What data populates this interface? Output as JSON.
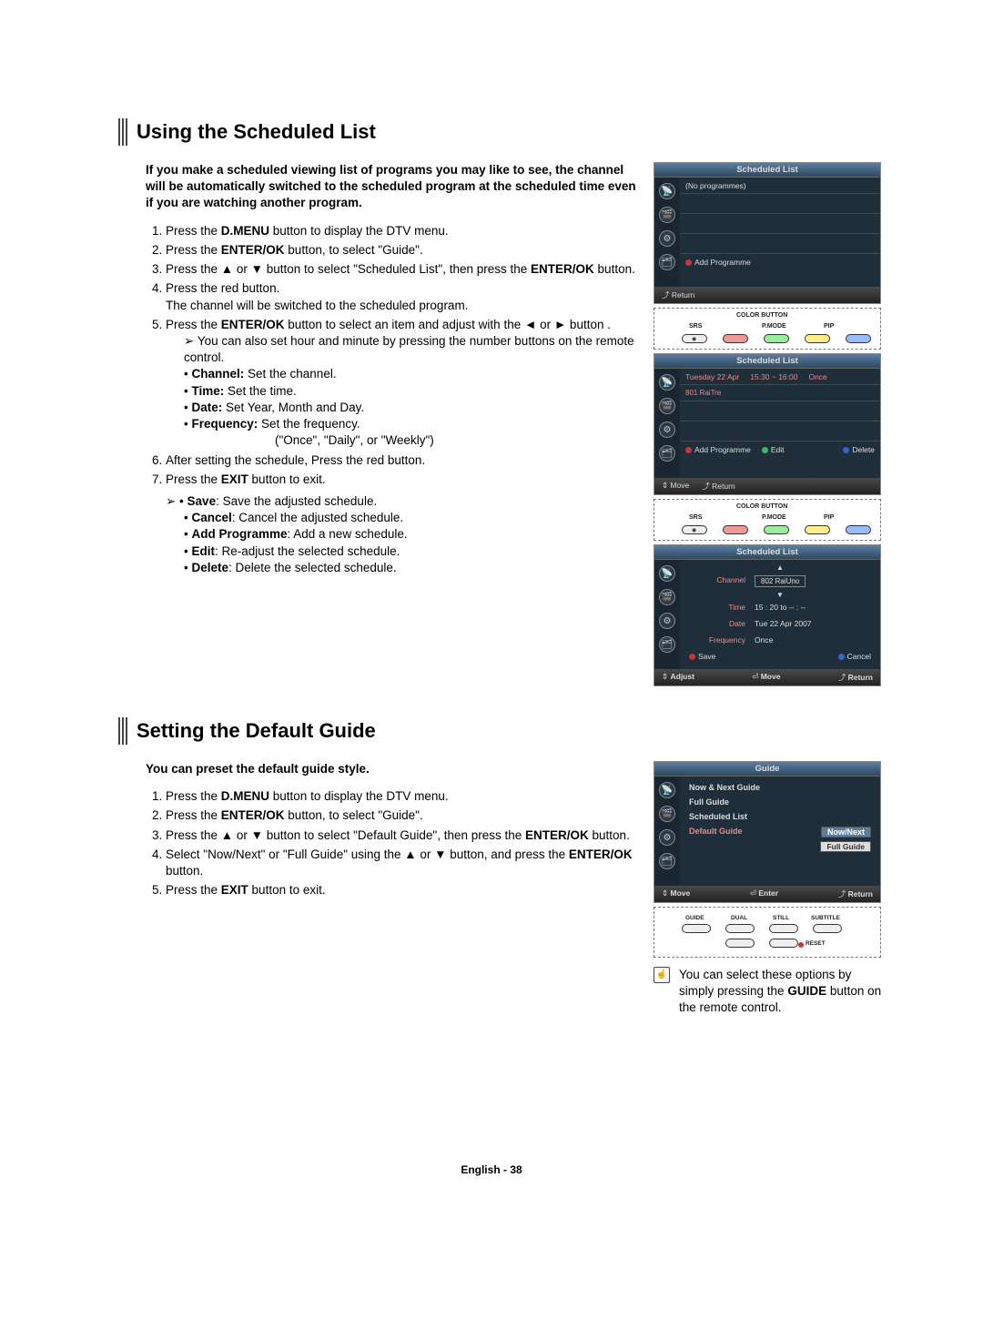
{
  "section1": {
    "title": "Using the Scheduled List",
    "intro": "If you make a scheduled viewing list of programs you may like to see, the channel will be automatically switched to the scheduled program at the scheduled time even if you are watching another program.",
    "s1a": "Press the ",
    "s1b": "D.MENU",
    "s1c": " button to display the DTV menu.",
    "s2a": "Press the ",
    "s2b": "ENTER/OK",
    "s2c": " button, to select \"Guide\".",
    "s3a": "Press the ▲ or ▼ button to select \"Scheduled List\", then press the ",
    "s3b": "ENTER/OK",
    "s3c": " button.",
    "s4a": "Press the red button.",
    "s4b": "The channel will be switched to the scheduled program.",
    "s5a": "Press the ",
    "s5b": "ENTER/OK",
    "s5c": " button to select an item and adjust with the ◄ or ► button .",
    "s5note": "You can also set hour and minute by pressing the number buttons on the remote control.",
    "s5_channel_k": "Channel:",
    "s5_channel_v": " Set the channel.",
    "s5_time_k": "Time:",
    "s5_time_v": " Set the time.",
    "s5_date_k": "Date:",
    "s5_date_v": " Set Year, Month and Day.",
    "s5_freq_k": "Frequency:",
    "s5_freq_v": " Set the frequency.",
    "s5_freq_v2": "(\"Once\", \"Daily\", or \"Weekly\")",
    "s6": "After setting the schedule, Press the red button.",
    "s7a": "Press the ",
    "s7b": "EXIT",
    "s7c": " button to exit.",
    "opt_save_k": "Save",
    "opt_save_v": ": Save the adjusted schedule.",
    "opt_cancel_k": "Cancel",
    "opt_cancel_v": ": Cancel the adjusted schedule.",
    "opt_add_k": "Add Programme",
    "opt_add_v": ": Add a new schedule.",
    "opt_edit_k": "Edit",
    "opt_edit_v": ": Re-adjust the selected schedule.",
    "opt_delete_k": "Delete",
    "opt_delete_v": ": Delete the selected schedule."
  },
  "section2": {
    "title": "Setting the Default Guide",
    "intro": "You can preset the default guide style.",
    "s1a": "Press the ",
    "s1b": "D.MENU",
    "s1c": " button to display the DTV menu.",
    "s2a": "Press the ",
    "s2b": "ENTER/OK",
    "s2c": " button, to select \"Guide\".",
    "s3a": "Press the ▲ or ▼ button to select \"Default Guide\", then press the ",
    "s3b": "ENTER/OK",
    "s3c": " button.",
    "s4a": "Select \"Now/Next\" or \"Full Guide\" using the ▲ or ▼ button, and press the ",
    "s4b": "ENTER/OK",
    "s4c": " button.",
    "s5a": "Press the ",
    "s5b": "EXIT",
    "s5c": " button to exit.",
    "tip": "You can select these options by simply pressing the ",
    "tip_b": "GUIDE",
    "tip_c": " button on the remote control."
  },
  "osd1": {
    "title": "Scheduled List",
    "row1": "(No programmes)",
    "add": "Add Programme",
    "return": "Return"
  },
  "osd2": {
    "title": "Scheduled List",
    "date": "Tuesday 22 Apr",
    "time": "15:30 ~ 16:00",
    "freq": "Once",
    "chan": "801 RaiTre",
    "add": "Add Programme",
    "edit": "Edit",
    "del": "Delete",
    "move": "Move",
    "return": "Return"
  },
  "osd3": {
    "title": "Scheduled List",
    "channel_k": "Channel",
    "channel_v": "802 RaiUno",
    "time_k": "Time",
    "time_v": "15 : 20 to -- : --",
    "date_k": "Date",
    "date_v": "Tue 22 Apr 2007",
    "freq_k": "Frequency",
    "freq_v": "Once",
    "save": "Save",
    "cancel": "Cancel",
    "adjust": "Adjust",
    "move": "Move",
    "return": "Return"
  },
  "osd4": {
    "title": "Guide",
    "m1": "Now & Next Guide",
    "m2": "Full Guide",
    "m3": "Scheduled List",
    "m4": "Default Guide",
    "sel": "Now/Next",
    "sel2": "Full Guide",
    "move": "Move",
    "enter": "Enter",
    "return": "Return"
  },
  "remote1": {
    "colorbtn": "COLOR BUTTON",
    "srs": "SRS",
    "pmode": "P.MODE",
    "pip": "PIP"
  },
  "remote2": {
    "guide": "GUIDE",
    "dual": "DUAL",
    "still": "STILL",
    "subtitle": "SUBTITLE",
    "reset": "RESET"
  },
  "footer": "English - 38"
}
